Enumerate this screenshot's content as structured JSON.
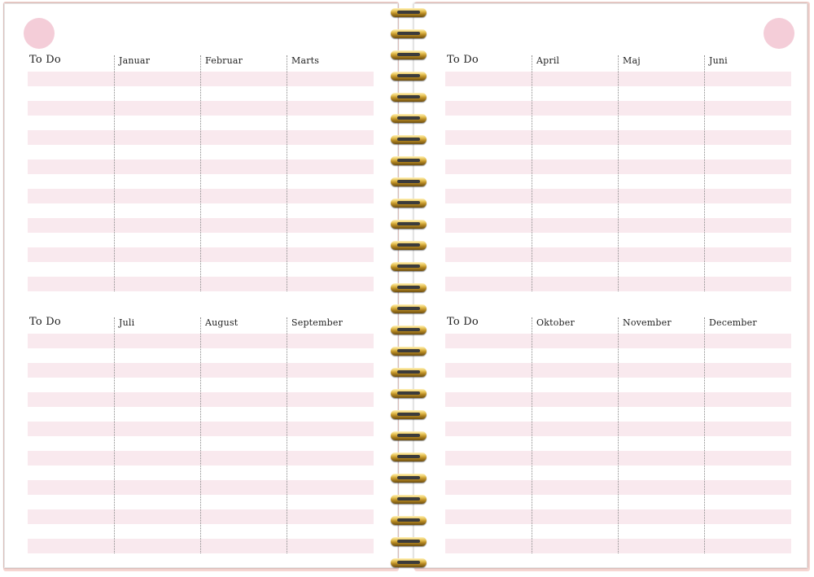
{
  "colors": {
    "band": "#f9e9ee",
    "punch": "#f4cdd8",
    "cover": "#f6d6d2"
  },
  "left_page": {
    "top": {
      "todo_label": "To Do",
      "months": [
        "Januar",
        "Februar",
        "Marts"
      ]
    },
    "bottom": {
      "todo_label": "To Do",
      "months": [
        "Juli",
        "August",
        "September"
      ]
    }
  },
  "right_page": {
    "top": {
      "todo_label": "To Do",
      "months": [
        "April",
        "Maj",
        "Juni"
      ]
    },
    "bottom": {
      "todo_label": "To Do",
      "months": [
        "Oktober",
        "November",
        "December"
      ]
    }
  },
  "ruled_rows_per_section": 8,
  "spiral": {
    "icon": "spiral-binding-icon",
    "coil_count": 27
  }
}
